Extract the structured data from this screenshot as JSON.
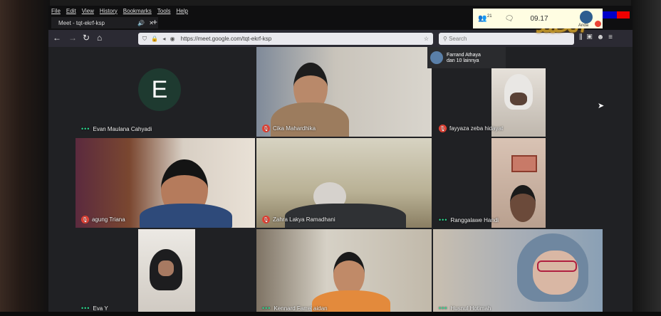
{
  "menu": [
    "File",
    "Edit",
    "View",
    "History",
    "Bookmarks",
    "Tools",
    "Help"
  ],
  "tab": {
    "title": "Meet - tqt-ekrf-ksp",
    "new_tab": "+"
  },
  "nav": {
    "url": "https://meet.google.com/tqt-ekrf-ksp",
    "search_placeholder": "Search"
  },
  "decor": {
    "calligraphy": "الحمد لله"
  },
  "overlay": {
    "name": "Farrand Athaya",
    "sub": "dan 10 lainnya"
  },
  "meet_top": {
    "participants_count": "21",
    "time": "09.17",
    "you_label": "Anda"
  },
  "participants": [
    {
      "name": "Evan Maulana Cahyadi",
      "muted": false,
      "avatar_letter": "E"
    },
    {
      "name": "Cika Mahardhika",
      "muted": true
    },
    {
      "name": "fayyaza zeba hidayat",
      "muted": true
    },
    {
      "name": "agung Triana",
      "muted": true
    },
    {
      "name": "Zahra Lakya Ramadhani",
      "muted": true
    },
    {
      "name": "Ranggalawe Handi",
      "muted": false
    },
    {
      "name": "Eva Y",
      "muted": false
    },
    {
      "name": "Kennard Farrel aidan",
      "muted": false
    },
    {
      "name": "Husnul Hotimah",
      "muted": false
    }
  ],
  "colors": {
    "meet_bg": "#202124",
    "mute_red": "#ea4335",
    "speaking_green": "#2bd98f",
    "topbar_bg": "#fffde2"
  }
}
